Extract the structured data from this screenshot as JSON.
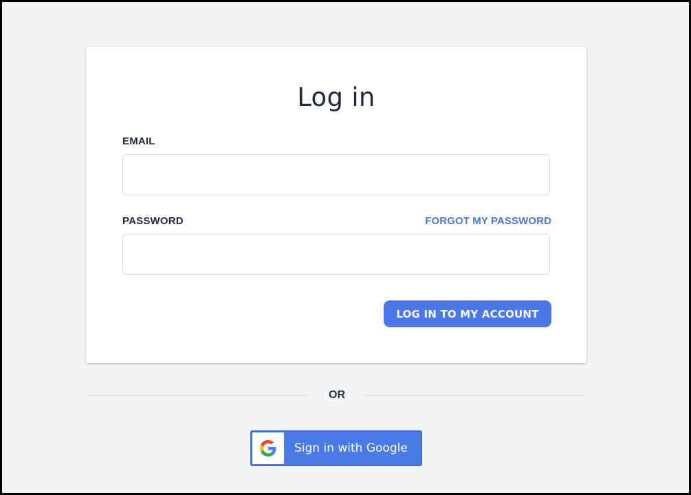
{
  "login_form": {
    "title": "Log in",
    "email_label": "EMAIL",
    "email_value": "",
    "password_label": "PASSWORD",
    "password_value": "",
    "forgot_password_link": "FORGOT MY PASSWORD",
    "submit_label": "LOG IN TO MY ACCOUNT"
  },
  "divider": {
    "text": "OR"
  },
  "google_sign_in": {
    "label": "Sign in with Google",
    "icon": "google-g-icon"
  },
  "colors": {
    "accent": "#4b77e8",
    "link": "#4a76e0",
    "background": "#f3f4f6",
    "text": "#1f2a3c"
  }
}
